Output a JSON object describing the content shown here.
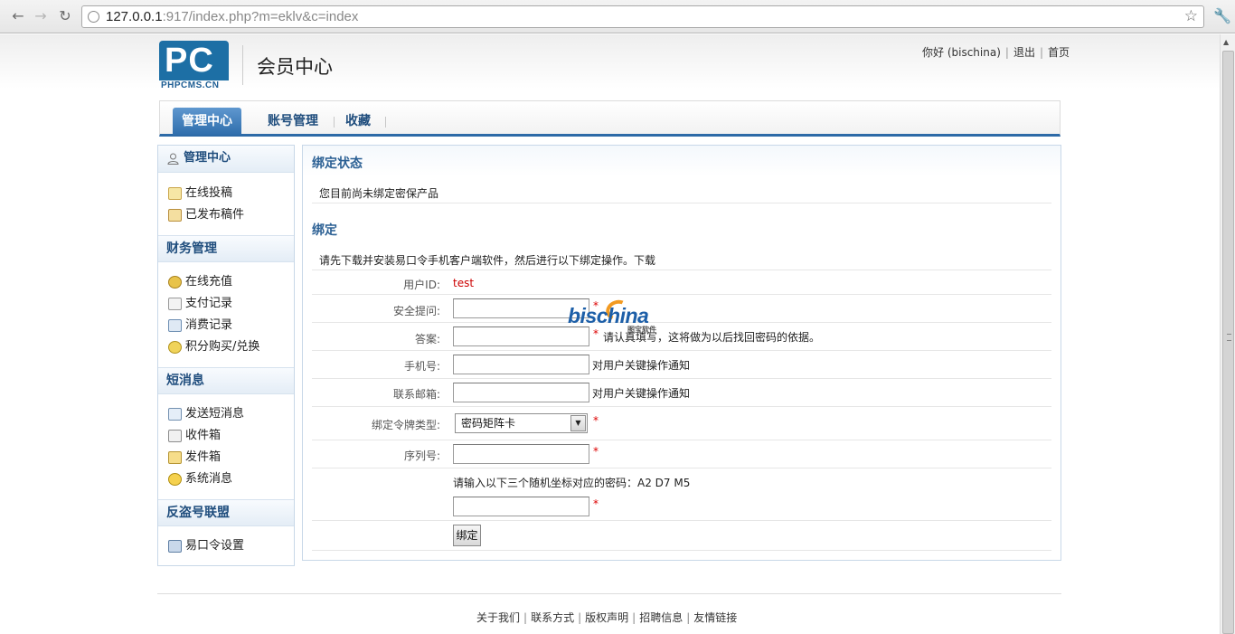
{
  "browser": {
    "url_host": "127.0.0.1",
    "url_rest": ":917/index.php?m=eklv&c=index"
  },
  "header": {
    "logo_text": "PC",
    "logo_sub": "PHPCMS.CN",
    "site_title": "会员中心",
    "greeting": "你好 (bischina)",
    "logout": "退出",
    "home": "首页"
  },
  "mainnav": {
    "tabs": [
      "管理中心",
      "账号管理",
      "收藏"
    ]
  },
  "sidebar": {
    "sections": [
      {
        "title": "管理中心",
        "items": [
          "在线投稿",
          "已发布稿件"
        ]
      },
      {
        "title": "财务管理",
        "items": [
          "在线充值",
          "支付记录",
          "消费记录",
          "积分购买/兑换"
        ]
      },
      {
        "title": "短消息",
        "items": [
          "发送短消息",
          "收件箱",
          "发件箱",
          "系统消息"
        ]
      },
      {
        "title": "反盗号联盟",
        "items": [
          "易口令设置"
        ]
      }
    ]
  },
  "content": {
    "status_title": "绑定状态",
    "status_text": "您目前尚未绑定密保产品",
    "bind_title": "绑定",
    "bind_intro": "请先下载并安装易口令手机客户端软件，然后进行以下绑定操作。下载",
    "userid_label": "用户ID:",
    "userid_value": "test",
    "question_label": "安全提问:",
    "answer_label": "答案:",
    "answer_hint": "请认真填写，这将做为以后找回密码的依据。",
    "mobile_label": "手机号:",
    "mobile_hint": "对用户关键操作通知",
    "email_label": "联系邮箱:",
    "email_hint": "对用户关键操作通知",
    "token_type_label": "绑定令牌类型:",
    "token_type_value": "密码矩阵卡",
    "serial_label": "序列号:",
    "coords_text": "请输入以下三个随机坐标对应的密码：A2 D7 M5",
    "required_mark": "*",
    "bind_button": "绑定"
  },
  "watermark": {
    "brand": "bischina",
    "sub": "图宝软件"
  },
  "footer": {
    "links": [
      "关于我们",
      "联系方式",
      "版权声明",
      "招聘信息",
      "友情链接"
    ]
  }
}
